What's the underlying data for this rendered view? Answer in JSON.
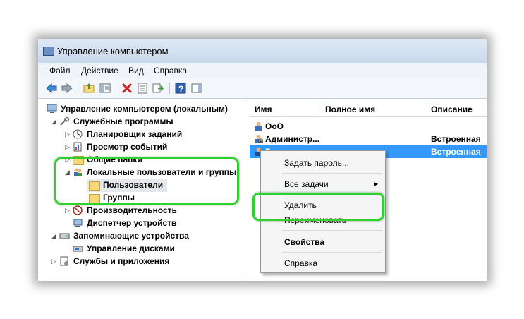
{
  "window": {
    "title": "Управление компьютером"
  },
  "menu": [
    "Файл",
    "Действие",
    "Вид",
    "Справка"
  ],
  "tree": {
    "root": "Управление компьютером (локальным)",
    "service_tools": "Служебные программы",
    "task_scheduler": "Планировщик заданий",
    "event_viewer": "Просмотр событий",
    "shared_folders": "Общие папки",
    "local_users": "Локальные пользователи и группы",
    "users": "Пользователи",
    "groups": "Группы",
    "performance": "Производительность",
    "device_manager": "Диспетчер устройств",
    "storage": "Запоминающие устройства",
    "disk_management": "Управление дисками",
    "services": "Службы и приложения"
  },
  "list": {
    "columns": [
      "Имя",
      "Полное имя",
      "Описание"
    ],
    "rows": [
      {
        "name": "OoO",
        "fullname": "",
        "description": ""
      },
      {
        "name": "Администр...",
        "fullname": "",
        "description": "Встроенная уч"
      },
      {
        "name": "Г",
        "fullname": "",
        "description": "Встроенная уч"
      }
    ]
  },
  "context_menu": {
    "items": [
      "Задать пароль...",
      "Все задачи",
      "Удалить",
      "Переименовать",
      "Свойства",
      "Справка"
    ],
    "submenu_arrow": "▶"
  },
  "colors": {
    "highlight": "#2fd12f",
    "selection": "#3399ff"
  }
}
